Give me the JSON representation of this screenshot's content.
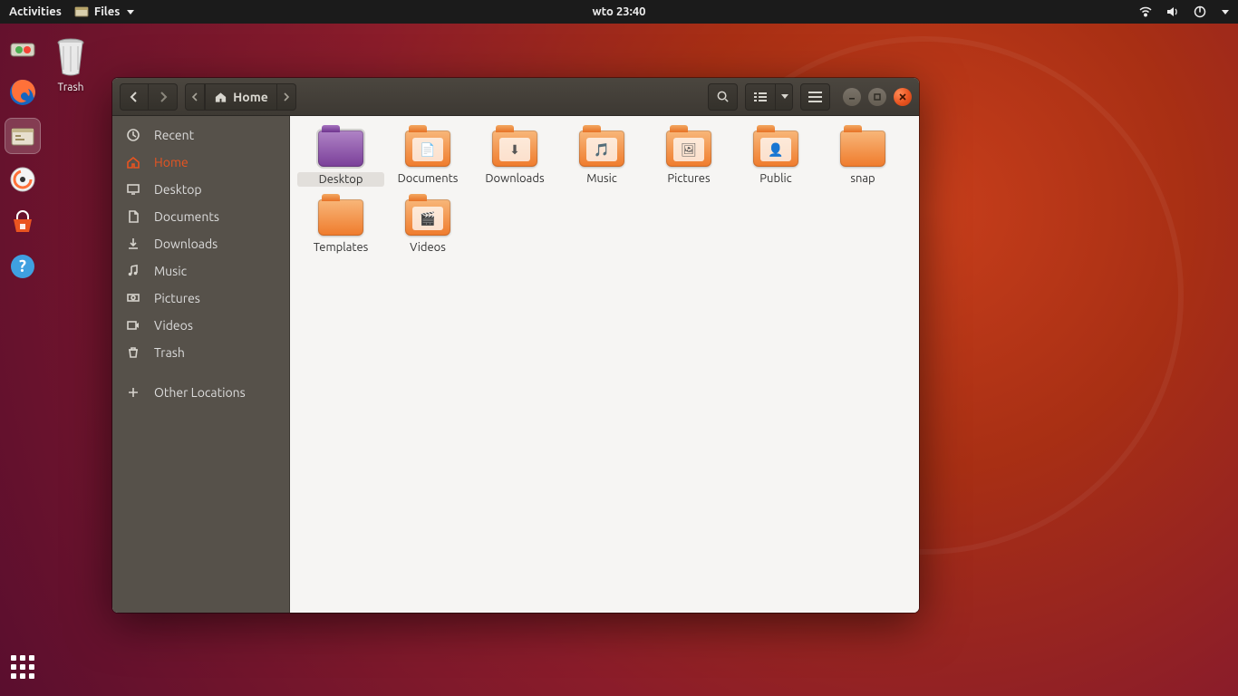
{
  "topbar": {
    "activities": "Activities",
    "app_menu": "Files",
    "clock": "wto 23:40"
  },
  "desktop": {
    "trash_label": "Trash"
  },
  "window": {
    "path_label": "Home",
    "sidebar": [
      {
        "icon": "clock",
        "label": "Recent"
      },
      {
        "icon": "home",
        "label": "Home",
        "selected": true
      },
      {
        "icon": "desktop",
        "label": "Desktop"
      },
      {
        "icon": "doc",
        "label": "Documents"
      },
      {
        "icon": "download",
        "label": "Downloads"
      },
      {
        "icon": "music",
        "label": "Music"
      },
      {
        "icon": "pictures",
        "label": "Pictures"
      },
      {
        "icon": "videos",
        "label": "Videos"
      },
      {
        "icon": "trash",
        "label": "Trash"
      },
      {
        "icon": "plus",
        "label": "Other Locations",
        "gap": true
      }
    ],
    "folders": [
      {
        "label": "Desktop",
        "badge": "",
        "special": "desktop",
        "selected": true
      },
      {
        "label": "Documents",
        "badge": "📄"
      },
      {
        "label": "Downloads",
        "badge": "⬇"
      },
      {
        "label": "Music",
        "badge": "🎵"
      },
      {
        "label": "Pictures",
        "badge": "🖼"
      },
      {
        "label": "Public",
        "badge": "👤"
      },
      {
        "label": "snap",
        "badge": ""
      },
      {
        "label": "Templates",
        "badge": ""
      },
      {
        "label": "Videos",
        "badge": "🎬"
      }
    ]
  }
}
